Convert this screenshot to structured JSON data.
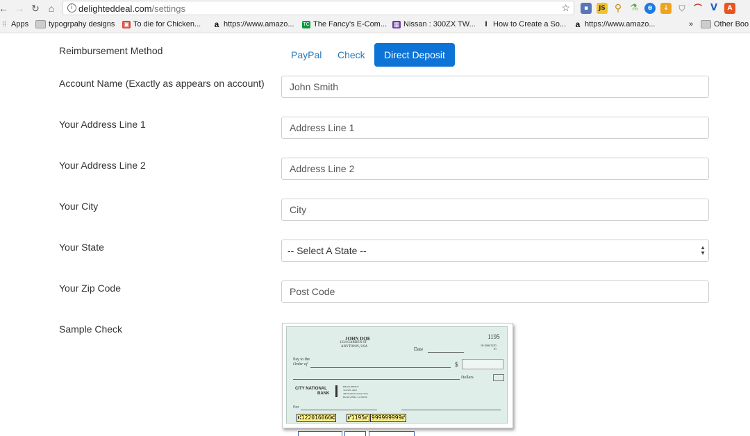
{
  "browser": {
    "url_host": "delighteddeal.com",
    "url_path": "/settings",
    "bookmarks": [
      {
        "label": "Apps",
        "icon": "apps-grid-icon"
      },
      {
        "label": "typogrpahy designs",
        "icon": "folder-icon"
      },
      {
        "label": "To die for Chicken...",
        "icon": "recipe-icon"
      },
      {
        "label": "https://www.amazo...",
        "icon": "amazon-icon"
      },
      {
        "label": "The Fancy's E-Com...",
        "icon": "techcrunch-icon"
      },
      {
        "label": "Nissan : 300ZX TW...",
        "icon": "tv-icon"
      },
      {
        "label": "How to Create a So...",
        "icon": "instructables-icon"
      },
      {
        "label": "https://www.amazo...",
        "icon": "amazon-icon"
      },
      {
        "label": "Other Boo",
        "icon": "folder-icon"
      }
    ],
    "overflow_label": "»"
  },
  "form": {
    "reimbursement_label": "Reimbursement Method",
    "methods": [
      "PayPal",
      "Check",
      "Direct Deposit"
    ],
    "active_method": "Direct Deposit",
    "account_name_label": "Account Name (Exactly as appears on account)",
    "account_name_value": "John Smith",
    "address1_label": "Your Address Line 1",
    "address1_placeholder": "Address Line 1",
    "address2_label": "Your Address Line 2",
    "address2_placeholder": "Address Line 2",
    "city_label": "Your City",
    "city_placeholder": "City",
    "state_label": "Your State",
    "state_selected": "-- Select A State --",
    "zip_label": "Your Zip Code",
    "zip_placeholder": "Post Code",
    "sample_check_label": "Sample Check"
  },
  "check": {
    "name": "JOHN DOE",
    "address1": "1234 GARDEN ST",
    "address2": "ANYTOWN, USA",
    "number": "1195",
    "fraction": "16-1666/1220",
    "fraction2": "01",
    "date_label": "Date",
    "payto_label": "Pay to the",
    "order_label": "Order of",
    "currency": "$",
    "dollars_label": "Dollars",
    "bank_name": "CITY NATIONAL",
    "bank_name2": "BANK",
    "bank_addr1": "HEAD OFFICE",
    "bank_addr2": "310-931-4202",
    "bank_addr3": "400 North Roxbury Drive",
    "bank_addr4": "Beverly Hills, CA 90210",
    "for_label": "For",
    "routing": "⑆122016066⑆",
    "check_num_micr": "⑈1195⑈",
    "account_micr": "999999999⑈"
  },
  "colors": {
    "accent": "#0d73d6",
    "link": "#2a7ab8",
    "check_bg": "#dfeee9"
  }
}
